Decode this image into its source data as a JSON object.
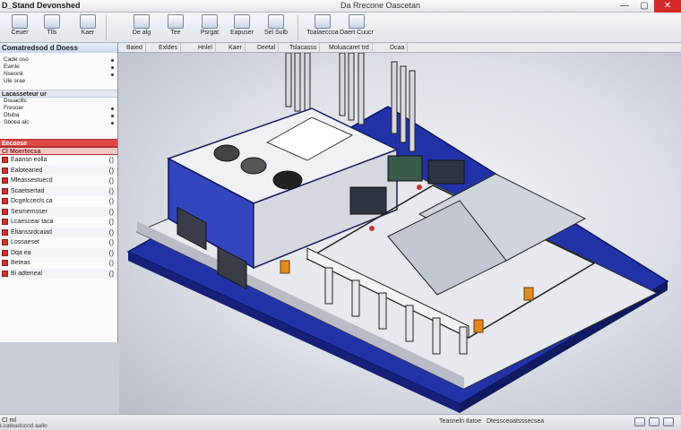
{
  "window": {
    "app_title": "D_Stand Devonshed",
    "doc_title": "Da Rrecone Oascetan",
    "minimize": "—",
    "maximize": "▢",
    "close": "✕"
  },
  "ribbon": {
    "buttons": [
      {
        "label": "Ceuer",
        "icon": "new-file-icon"
      },
      {
        "label": "Tlls",
        "icon": "tools-icon"
      },
      {
        "label": "Kaer",
        "icon": "layer-icon"
      },
      {
        "label": "De alg",
        "icon": "part-icon"
      },
      {
        "label": "Tee",
        "icon": "assembly-icon"
      },
      {
        "label": "Psrgat",
        "icon": "sketch-icon"
      },
      {
        "label": "Eapuser",
        "icon": "feature-icon"
      },
      {
        "label": "Sel Sulb",
        "icon": "surface-icon"
      },
      {
        "label": "Toalaeccoa",
        "icon": "render-icon"
      },
      {
        "label": "Daert Cuucr",
        "icon": "drawing-icon"
      }
    ]
  },
  "cmdbar": {
    "panel_title": "Comatredsod d Doess",
    "tabs": [
      "Baied",
      "Exldes",
      "Hnlel",
      "Kaer",
      "Deetal",
      "Tslacasss",
      "Moluacaret trd",
      "Dcaa"
    ]
  },
  "leftpanel": {
    "section1": [
      "Cade oso",
      "Ewnle",
      "Nseonk",
      "Ule srae"
    ],
    "section1_header": "Lacasseteur ur",
    "section2": [
      "Dsuaclllc",
      "Fresoer",
      "Dtuba",
      "Sbcea alc"
    ],
    "section3_header": "Eecaese",
    "list_header": "Cl Moertecsa",
    "list": [
      {
        "label": "Eaansn eolla",
        "par": "()"
      },
      {
        "label": "Ealoteaned",
        "par": "()"
      },
      {
        "label": "Mleassestuecd",
        "par": "()"
      },
      {
        "label": "Scaetsertad",
        "par": "()"
      },
      {
        "label": "Dcgelccecls ca",
        "par": "()"
      },
      {
        "label": "Sesmemsser",
        "par": "()"
      },
      {
        "label": "Lcaescear taca",
        "par": "()"
      },
      {
        "label": "Eltanssrdcaiad",
        "par": "()"
      },
      {
        "label": "Lossaeset",
        "par": "()"
      },
      {
        "label": "Dqa ea",
        "par": "()"
      },
      {
        "label": "Beteas",
        "par": "()"
      },
      {
        "label": "Bi adteneal",
        "par": "()"
      }
    ]
  },
  "statusbar": {
    "left": "Cl ml",
    "mid": "Lcateadocnd aallo",
    "right": "Teasneln tlatoe",
    "right2": "Dtessceoatsssecsea"
  },
  "colors": {
    "accent_blue": "#2a3fb0",
    "panel_red": "#e04848"
  }
}
